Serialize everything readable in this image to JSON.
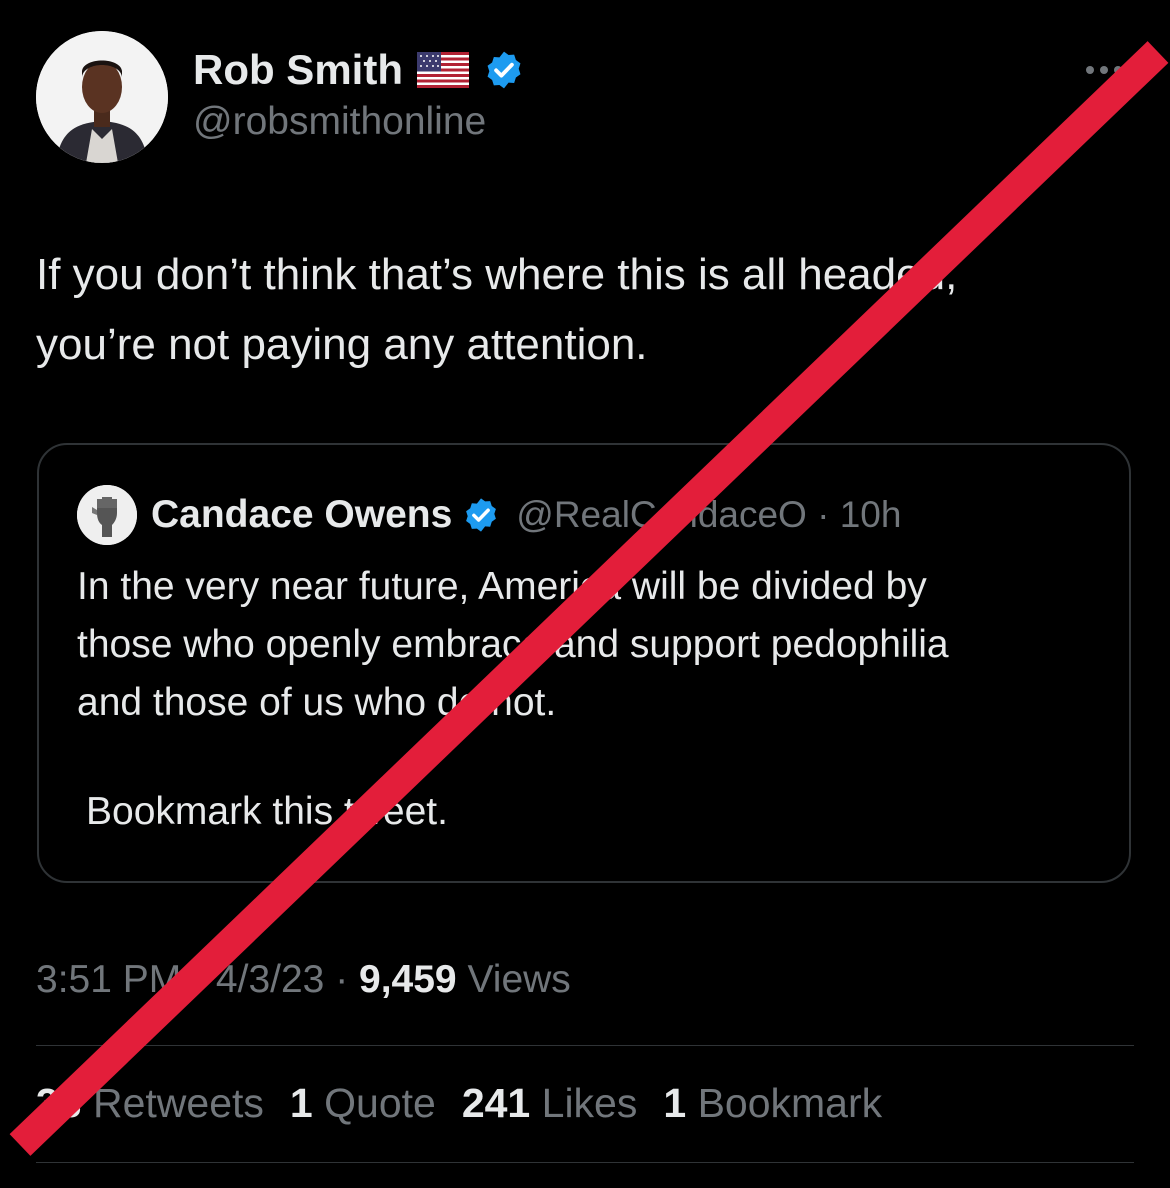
{
  "author": {
    "name": "Rob Smith",
    "handle": "@robsmithonline",
    "flag_icon": "us-flag-icon",
    "verified_color": "#1d9bf0"
  },
  "tweet": {
    "lines": [
      "If you don’t think that’s where this is all headed,",
      "you’re not paying any attention."
    ]
  },
  "quote": {
    "name": "Candace Owens",
    "handle": "@RealCandaceO",
    "separator": " · ",
    "time": "10h",
    "lines": [
      "In the very near future, America will be divided by",
      "those who openly embrace and support pedophilia",
      "and those of us who do not."
    ],
    "bookmark_line": "Bookmark this tweet."
  },
  "meta": {
    "time": "3:51 PM",
    "date": "4/3/23",
    "separator": " · ",
    "views_count": "9,459",
    "views_label": " Views"
  },
  "stats": {
    "retweets_count": "33",
    "retweets_label": " Retweets",
    "quotes_count": "1",
    "quotes_label": " Quote",
    "likes_count": "241",
    "likes_label": " Likes",
    "bookmarks_count": "1",
    "bookmarks_label": " Bookmark"
  },
  "overlay": {
    "slash_color": "#e31e3a"
  }
}
